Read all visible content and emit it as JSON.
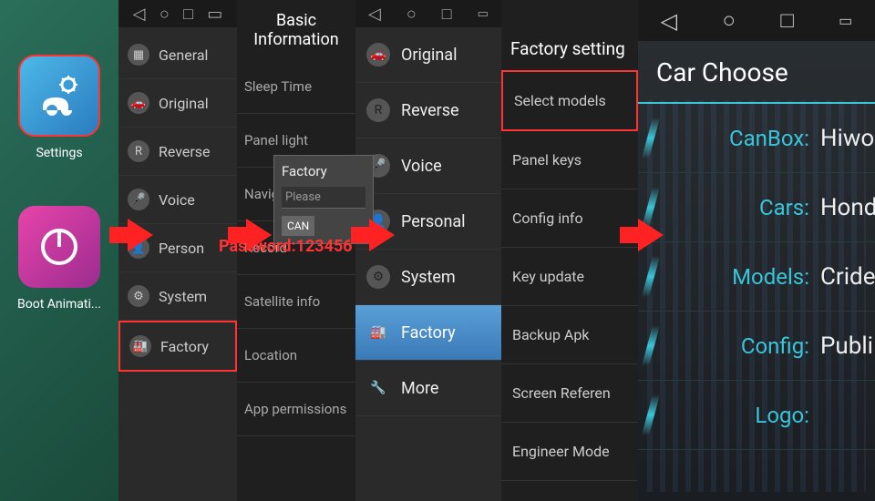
{
  "panel1": {
    "settings_label": "Settings",
    "boot_label": "Boot Animati..."
  },
  "panel2": {
    "items": [
      {
        "label": "General"
      },
      {
        "label": "Original"
      },
      {
        "label": "Reverse"
      },
      {
        "label": "Voice"
      },
      {
        "label": "Person"
      },
      {
        "label": "System"
      },
      {
        "label": "Factory"
      }
    ]
  },
  "panel3": {
    "header": "Basic Information",
    "items": [
      {
        "label": "Sleep Time"
      },
      {
        "label": "Panel light"
      },
      {
        "label": "Naviga"
      },
      {
        "label": "Record"
      },
      {
        "label": "Satellite info"
      },
      {
        "label": "Location"
      },
      {
        "label": "App permissions"
      }
    ],
    "dialog": {
      "title": "Factory",
      "placeholder": "Please",
      "cancel": "CAN"
    },
    "password_text": "Password:123456"
  },
  "panel4": {
    "items": [
      {
        "label": "Original",
        "icon": "car"
      },
      {
        "label": "Reverse",
        "icon": "R"
      },
      {
        "label": "Voice",
        "icon": "mic"
      },
      {
        "label": "Personal",
        "icon": "person"
      },
      {
        "label": "System",
        "icon": "gear"
      },
      {
        "label": "Factory",
        "icon": "bldg"
      },
      {
        "label": "More",
        "icon": "wrench"
      }
    ]
  },
  "panel5": {
    "header": "Factory setting",
    "items": [
      {
        "label": "Select models"
      },
      {
        "label": "Panel keys"
      },
      {
        "label": "Config info"
      },
      {
        "label": "Key update"
      },
      {
        "label": "Backup Apk"
      },
      {
        "label": "Screen Referen"
      },
      {
        "label": "Engineer Mode"
      }
    ]
  },
  "panel6": {
    "header": "Car Choose",
    "rows": [
      {
        "label": "CanBox:",
        "value": "Hiwo"
      },
      {
        "label": "Cars:",
        "value": "Hond"
      },
      {
        "label": "Models:",
        "value": "Cride"
      },
      {
        "label": "Config:",
        "value": "Publi"
      },
      {
        "label": "Logo:",
        "value": ""
      }
    ]
  }
}
